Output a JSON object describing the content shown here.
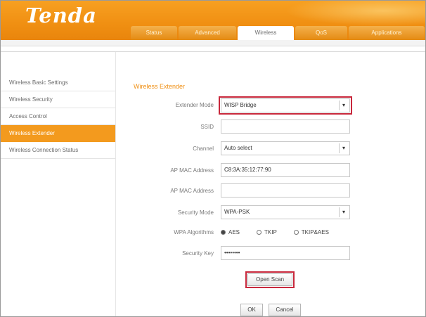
{
  "header": {
    "logo": "Tenda",
    "tabs": [
      {
        "label": "Status",
        "active": false
      },
      {
        "label": "Advanced",
        "active": false
      },
      {
        "label": "Wireless",
        "active": true
      },
      {
        "label": "QoS",
        "active": false
      },
      {
        "label": "Applications",
        "active": false
      }
    ]
  },
  "sidebar": {
    "items": [
      {
        "label": "Wireless Basic Settings",
        "active": false
      },
      {
        "label": "Wireless Security",
        "active": false
      },
      {
        "label": "Access Control",
        "active": false
      },
      {
        "label": "Wireless Extender",
        "active": true
      },
      {
        "label": "Wireless Connection Status",
        "active": false
      }
    ]
  },
  "main": {
    "section_title": "Wireless Extender",
    "extender_mode": {
      "label": "Extender Mode",
      "value": "WISP Bridge"
    },
    "ssid": {
      "label": "SSID",
      "value": ""
    },
    "channel": {
      "label": "Channel",
      "value": "Auto select"
    },
    "ap_mac": {
      "label": "AP MAC Address",
      "value": "C8:3A:35:12:77:90"
    },
    "ap_mac2": {
      "label": "AP MAC Address",
      "value": ""
    },
    "security_mode": {
      "label": "Security Mode",
      "value": "WPA-PSK"
    },
    "wpa_algorithms": {
      "label": "WPA Algorithms",
      "options": [
        {
          "label": "AES",
          "selected": true
        },
        {
          "label": "TKIP",
          "selected": false
        },
        {
          "label": "TKIP&AES",
          "selected": false
        }
      ]
    },
    "security_key": {
      "label": "Security Key",
      "value": "••••••••"
    },
    "open_scan_label": "Open Scan",
    "ok_label": "OK",
    "cancel_label": "Cancel"
  },
  "colors": {
    "brand_orange": "#f08f12",
    "highlight_red": "#c8283c"
  }
}
